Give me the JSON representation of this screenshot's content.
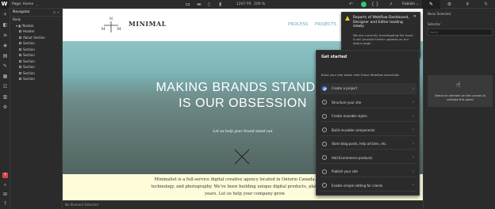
{
  "topbar": {
    "logo": "W",
    "page_label": "Page: Home",
    "page_caret": "⌄",
    "devices": [
      "▭",
      "▬",
      "▯",
      "▮"
    ],
    "size": "1207 PX",
    "zoom": "100 %",
    "icons": {
      "undo": "↶",
      "preview": "◉",
      "code": "{ }",
      "share": "↗"
    },
    "publish": "Publish ⌄",
    "right_icons": [
      "✎",
      "⚙",
      "⚘",
      "ϟ"
    ]
  },
  "leftbar": {
    "icons": [
      "+",
      "◧",
      "≡",
      "◈",
      "▤",
      "✎",
      "▦",
      "☷",
      "▥",
      "⚙"
    ],
    "bottom_icons": [
      "?",
      "⌕",
      "⊞",
      "?"
    ]
  },
  "navigator": {
    "title": "Navigator",
    "controls": "⊡ ✕",
    "items": [
      {
        "label": "Body",
        "indent": 0,
        "box": false
      },
      {
        "label": "▾ ◧ Navbar",
        "indent": 1,
        "box": false
      },
      {
        "label": "Header",
        "indent": 2,
        "box": true
      },
      {
        "label": "About Section",
        "indent": 2,
        "box": true
      },
      {
        "label": "Section",
        "indent": 2,
        "box": true
      },
      {
        "label": "Section",
        "indent": 2,
        "box": true
      },
      {
        "label": "Section",
        "indent": 2,
        "box": true
      },
      {
        "label": "Section",
        "indent": 2,
        "box": true
      },
      {
        "label": "Section",
        "indent": 2,
        "box": true
      },
      {
        "label": "Section",
        "indent": 2,
        "box": true
      },
      {
        "label": "Section",
        "indent": 2,
        "box": true
      }
    ]
  },
  "canvas": {
    "logo_letters": [
      "N",
      "M",
      "M"
    ],
    "logo_text": "MINIMAL",
    "nav": [
      "PROCESS",
      "PROJECTS"
    ],
    "hero_title_1": "MAKING BRANDS STAND O",
    "hero_title_2": "IS OUR OBSESSION",
    "hero_sub": "Let us help your brand stand out",
    "about_lines": [
      "Minimalist is a full-service digital creative agency located in Ontorio Canada. We focus",
      "technology, and photography. We've been building unique digital products, platforms, and",
      "years. Let us help your company grow."
    ]
  },
  "statusbar": {
    "text": "No Element Selected"
  },
  "right_panel": {
    "none_selected": "None Selected",
    "selector_label": "Selector",
    "selector_placeholder": "None",
    "empty_msg": "Select an element on the canvas to activate this panel",
    "hand_icon": "☝"
  },
  "toast": {
    "title": "Reports of Webflow Dashboard, Designer and Editor loading slowly",
    "body": "We are currently investigating the issue & will provide further updates on our status page",
    "link": "View status page",
    "close": "✕"
  },
  "get_started": {
    "title": "Get started",
    "description": "Build your site faster with these Webflow essentials",
    "items": [
      {
        "label": "Create a project",
        "done": true
      },
      {
        "label": "Structure your site",
        "done": false
      },
      {
        "label": "Create reusable styles",
        "done": false
      },
      {
        "label": "Build reusable components",
        "done": false
      },
      {
        "label": "Store blog posts, help articles, etc.",
        "done": false
      },
      {
        "label": "Add Ecommerce products",
        "done": false
      },
      {
        "label": "Publish your site",
        "done": false
      },
      {
        "label": "Enable simple editing for clients",
        "done": false
      }
    ],
    "chevron": "›"
  },
  "colors": {
    "accent": "#4a8cf7",
    "warning": "#f5c518",
    "publish_ok": "#2ecc71",
    "hero": "#79b1b3",
    "about_bg": "#fefcd9"
  }
}
